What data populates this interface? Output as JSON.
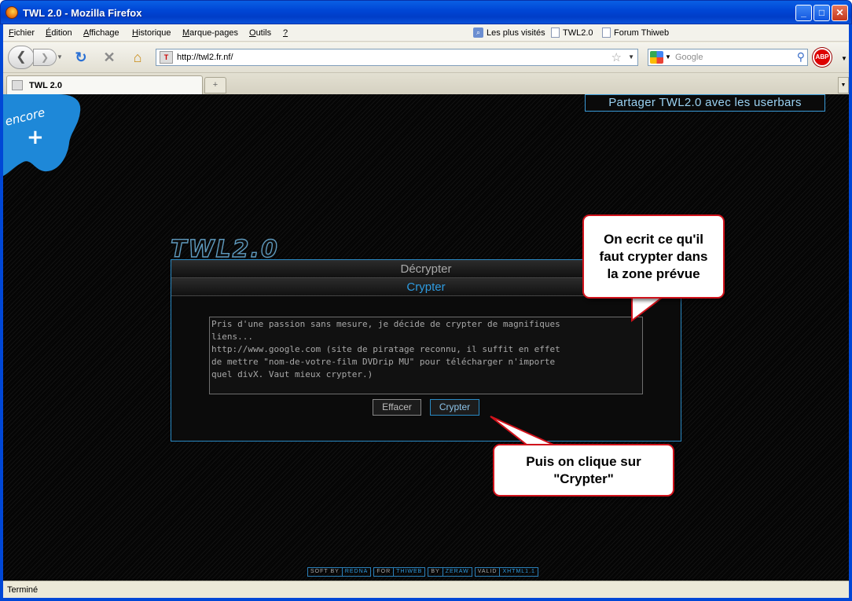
{
  "window": {
    "title": "TWL 2.0 - Mozilla Firefox",
    "min": "_",
    "max": "□",
    "close": "✕"
  },
  "menu": {
    "fichier": {
      "u": "F",
      "rest": "ichier"
    },
    "edition": {
      "u": "É",
      "rest": "dition"
    },
    "affichage": {
      "u": "A",
      "rest": "ffichage"
    },
    "historique": {
      "u": "H",
      "rest": "istorique"
    },
    "marque": {
      "u": "M",
      "rest": "arque-pages"
    },
    "outils": {
      "u": "O",
      "rest": "utils"
    },
    "aide": {
      "u": "?",
      "rest": ""
    }
  },
  "bookmarks": [
    "Les plus visités",
    "TWL2.0",
    "Forum Thiweb"
  ],
  "url": "http://twl2.fr.nf/",
  "search_placeholder": "Google",
  "abp_label": "ABP",
  "tab_title": "TWL 2.0",
  "newtab_icon": "+",
  "status": "Terminé",
  "page": {
    "share": "Partager TWL2.0 avec les userbars",
    "logo_text": "TWL2.0",
    "encore": "encore",
    "tab_decrypt": "Décrypter",
    "tab_crypt": "Crypter",
    "textarea": "Pris d'une passion sans mesure, je décide de crypter de magnifiques\nliens...\nhttp://www.google.com (site de piratage reconnu, il suffit en effet\nde mettre \"nom-de-votre-film DVDrip MU\" pour télécharger n'importe\nquel divX. Vaut mieux crypter.)",
    "btn_clear": "Effacer",
    "btn_crypt": "Crypter",
    "callout1": "On ecrit ce qu'il\nfaut crypter dans\nla zone prévue",
    "callout2": "Puis on clique sur\n\"Crypter\"",
    "footer": [
      {
        "k": "SOFT BY",
        "v": "REDNA"
      },
      {
        "k": "FOR",
        "v": "THIWEB"
      },
      {
        "k": "BY",
        "v": "ZERAW"
      },
      {
        "k": "VALID",
        "v": "XHTML1.1"
      }
    ]
  },
  "colors": {
    "accent": "#2e9be0",
    "callout_border": "#d0121b",
    "page_bg": "#050505",
    "blob": "#1e88d8"
  }
}
